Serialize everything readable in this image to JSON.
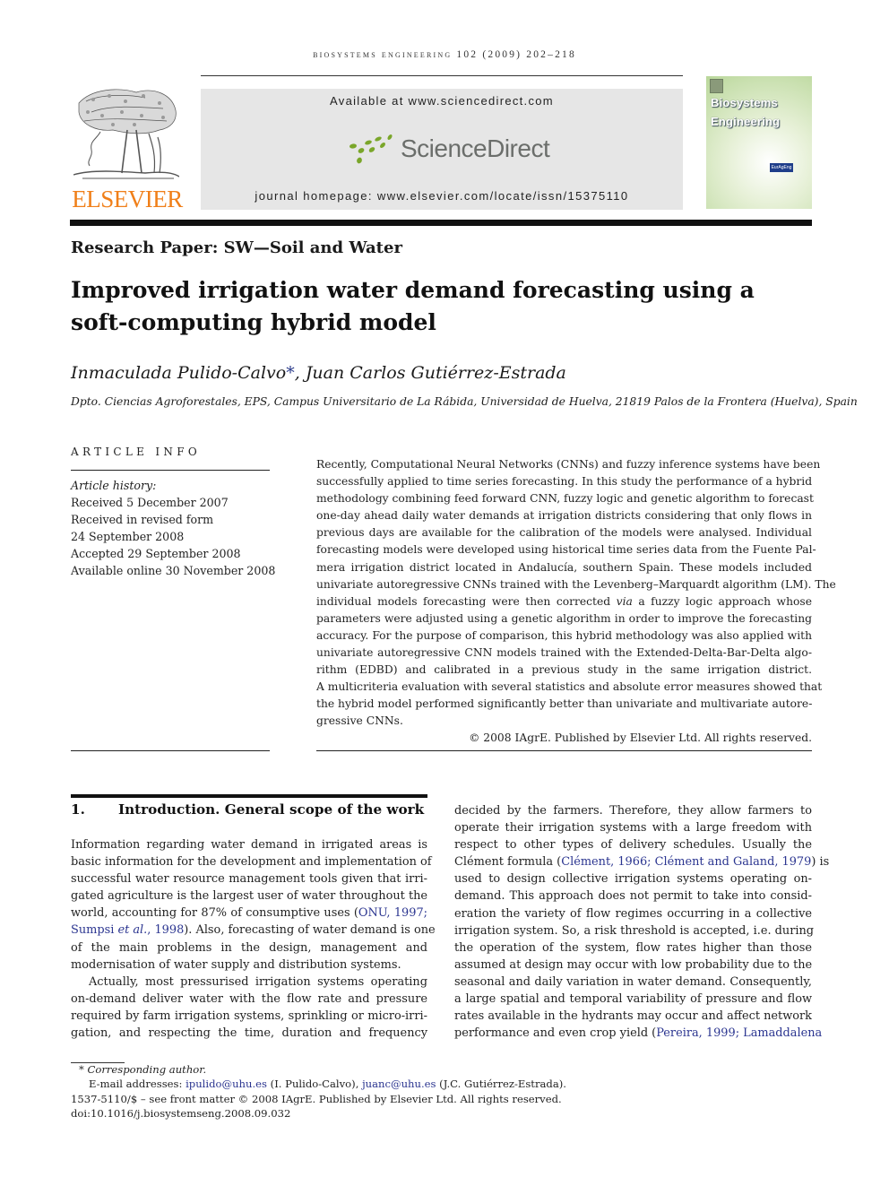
{
  "running_head": "Biosystems Engineering 102 (2009) 202–218",
  "header": {
    "publisher_wordmark": "ELSEVIER",
    "publisher_logo_icon": "elsevier-tree-icon",
    "available_at": "Available at www.sciencedirect.com",
    "platform_name": "ScienceDirect",
    "platform_logo_icon": "sciencedirect-dots-icon",
    "journal_homepage": "journal homepage: www.elsevier.com/locate/issn/15375110",
    "cover": {
      "title_line1": "Biosystems",
      "title_line2": "Engineering",
      "badge": "EurAgEng"
    },
    "colors": {
      "elsevier_orange": "#f07f19",
      "sd_green": "#7aa62a",
      "sd_gray": "#6b6e6b",
      "link_blue": "#2b3590"
    }
  },
  "article": {
    "section_label": "Research Paper: SW—Soil and Water",
    "title_line1": "Improved irrigation water demand forecasting using a",
    "title_line2": "soft-computing hybrid model",
    "authors": [
      {
        "name": "Inmaculada Pulido-Calvo",
        "mark": "*"
      },
      {
        "name": "Juan Carlos Gutiérrez-Estrada",
        "mark": ""
      }
    ],
    "author_separator": ", ",
    "affiliation": "Dpto. Ciencias Agroforestales, EPS, Campus Universitario de La Rábida, Universidad de Huelva, 21819 Palos de la Frontera (Huelva), Spain"
  },
  "article_info": {
    "heading": "ARTICLE INFO",
    "history_label": "Article history:",
    "history": [
      "Received 5 December 2007",
      "Received in revised form",
      "24 September 2008",
      "Accepted 29 September 2008",
      "Available online 30 November 2008"
    ]
  },
  "abstract": {
    "lines": [
      "Recently, Computational Neural Networks (CNNs) and fuzzy inference systems have been",
      "successfully applied to time series forecasting. In this study the performance of a hybrid",
      "methodology combining feed forward CNN, fuzzy logic and genetic algorithm to forecast",
      "one-day ahead daily water demands at irrigation districts considering that only flows in",
      "previous days are available for the calibration of the models were analysed. Individual",
      "forecasting models were developed using historical time series data from the Fuente Pal-",
      "mera irrigation district located in Andalucía, southern Spain. These models included",
      "univariate autoregressive CNNs trained with the Levenberg–Marquardt algorithm (LM). The",
      "individual models forecasting were then corrected |via| a fuzzy logic approach whose",
      "parameters were adjusted using a genetic algorithm in order to improve the forecasting",
      "accuracy. For the purpose of comparison, this hybrid methodology was also applied with",
      "univariate autoregressive CNN models trained with the Extended-Delta-Bar-Delta algo-",
      "rithm (EDBD) and calibrated in a previous study in the same irrigation district.",
      "A multicriteria evaluation with several statistics and absolute error measures showed that",
      "the hybrid model performed significantly better than univariate and multivariate autore-",
      "gressive CNNs."
    ],
    "line8_pre": "individual models forecasting were then corrected ",
    "line8_italic": "via",
    "line8_post": " a fuzzy logic approach whose",
    "copyright": "© 2008 IAgrE. Published by Elsevier Ltd. All rights reserved."
  },
  "intro": {
    "number": "1.",
    "heading": "Introduction. General scope of the work",
    "col1": {
      "l1": "Information regarding water demand in irrigated areas is",
      "l2": "basic information for the development and implementation of",
      "l3": "successful water resource management tools given that irri-",
      "l4": "gated agriculture is the largest user of water throughout the",
      "l5_pre": "world, accounting for 87% of consumptive uses (",
      "l5_ref": "ONU, 1997;",
      "l6_ref_a": "Sumpsi ",
      "l6_ref_it": "et al.",
      "l6_ref_b": ", 1998",
      "l6_post": "). Also, forecasting of water demand is one",
      "l7": "of the main problems in the design, management and",
      "l8": "modernisation of water supply and distribution systems.",
      "l9": "Actually, most pressurised irrigation systems operating",
      "l10": "on-demand deliver water with the flow rate and pressure",
      "l11": "required by farm irrigation systems, sprinkling or micro-irri-",
      "l12": "gation, and respecting the time, duration and frequency"
    },
    "col2": {
      "l1": "decided by the farmers. Therefore, they allow farmers to",
      "l2": "operate their irrigation systems with a large freedom with",
      "l3": "respect to other types of delivery schedules. Usually the",
      "l4_pre": "Clément formula (",
      "l4_ref1": "Clément, 1966",
      "l4_sep": "; ",
      "l4_ref2": "Clément and Galand, 1979",
      "l4_post": ") is",
      "l5": "used to design collective irrigation systems operating on-",
      "l6": "demand. This approach does not permit to take into consid-",
      "l7": "eration the variety of flow regimes occurring in a collective",
      "l8": "irrigation system. So, a risk threshold is accepted, i.e. during",
      "l9": "the operation of the system, flow rates higher than those",
      "l10": "assumed at design may occur with low probability due to the",
      "l11": "seasonal and daily variation in water demand. Consequently,",
      "l12": "a large spatial and temporal variability of pressure and flow",
      "l13": "rates available in the hydrants may occur and affect network",
      "l14_pre": "performance and even crop yield (",
      "l14_ref1": "Pereira, 1999",
      "l14_sep": "; ",
      "l14_ref2": "Lamaddalena"
    }
  },
  "footnotes": {
    "mark": "*",
    "corresponding": "Corresponding author.",
    "email_label": "E-mail addresses: ",
    "email1": "ipulido@uhu.es",
    "email1_name": " (I. Pulido-Calvo), ",
    "email2": "juanc@uhu.es",
    "email2_name": " (J.C. Gutiérrez-Estrada).",
    "front_matter": "1537-5110/$ – see front matter © 2008 IAgrE. Published by Elsevier Ltd. All rights reserved.",
    "doi": "doi:10.1016/j.biosystemseng.2008.09.032"
  }
}
